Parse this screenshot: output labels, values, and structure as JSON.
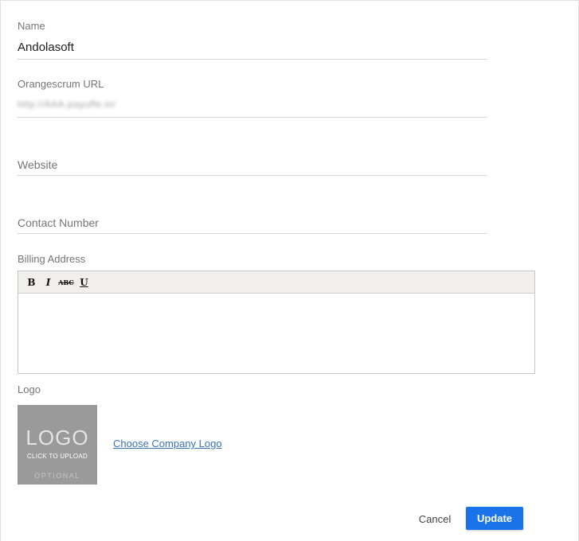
{
  "form": {
    "name": {
      "label": "Name",
      "value": "Andolasoft"
    },
    "orangescrum_url": {
      "label": "Orangescrum URL",
      "value": "http://AAA.payuffe.in/"
    },
    "website": {
      "placeholder": "Website",
      "value": ""
    },
    "contact_number": {
      "placeholder": "Contact Number",
      "value": ""
    },
    "billing_address": {
      "label": "Billing Address",
      "toolbar": {
        "bold": "B",
        "italic": "I",
        "strikethrough": "ABC",
        "underline": "U"
      },
      "value": ""
    },
    "logo": {
      "label": "Logo",
      "placeholder_title": "LOGO",
      "placeholder_subtitle": "CLICK TO UPLOAD",
      "placeholder_note": "OPTIONAL",
      "choose_link": "Choose Company Logo"
    }
  },
  "actions": {
    "cancel_label": "Cancel",
    "update_label": "Update"
  },
  "colors": {
    "primary_button": "#1a73e8",
    "link": "#3b73b9",
    "logo_placeholder_bg": "#9a9a9a",
    "toolbar_bg": "#f0efec"
  },
  "icons": {
    "bold": "bold-icon",
    "italic": "italic-icon",
    "strikethrough": "strikethrough-icon",
    "underline": "underline-icon"
  }
}
